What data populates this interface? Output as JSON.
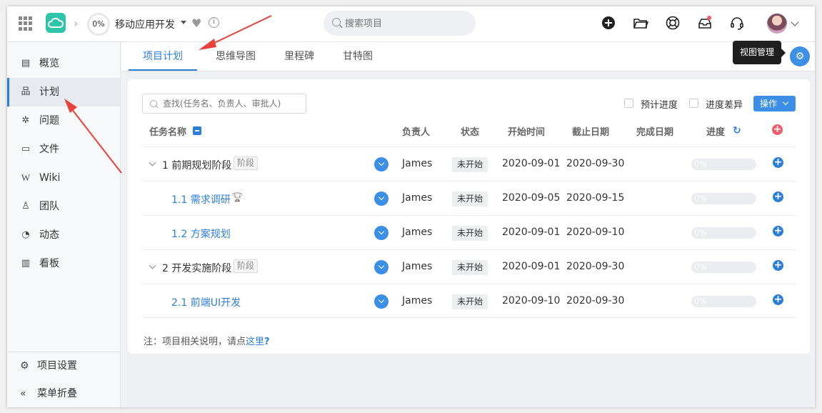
{
  "topbar": {
    "progress": "0%",
    "project_name": "移动应用开发",
    "search_placeholder": "搜索项目",
    "icons": [
      "apps-grid-icon",
      "cloud-logo-icon",
      "heart-icon",
      "info-icon",
      "add-icon",
      "folder-icon",
      "help-buoy-icon",
      "inbox-icon",
      "headset-icon"
    ],
    "notification_dot_color": "#f25b6b"
  },
  "sidebar": {
    "items": [
      {
        "label": "概览",
        "icon": "overview-icon"
      },
      {
        "label": "计划",
        "icon": "hierarchy-icon",
        "active": true
      },
      {
        "label": "问题",
        "icon": "bug-icon"
      },
      {
        "label": "文件",
        "icon": "folder-icon"
      },
      {
        "label": "Wiki",
        "icon": "wiki-icon"
      },
      {
        "label": "团队",
        "icon": "team-icon"
      },
      {
        "label": "动态",
        "icon": "activity-icon"
      },
      {
        "label": "看板",
        "icon": "board-icon"
      }
    ],
    "bottom": [
      {
        "label": "项目设置",
        "icon": "settings-icon"
      },
      {
        "label": "菜单折叠",
        "icon": "collapse-icon"
      }
    ]
  },
  "tabs": [
    {
      "label": "项目计划",
      "active": true
    },
    {
      "label": "思维导图"
    },
    {
      "label": "里程碑"
    },
    {
      "label": "甘特图"
    }
  ],
  "tooltip": "视图管理",
  "toolbar": {
    "filter_placeholder": "查找(任务名、负责人、审批人)",
    "checkbox_estimated": "预计进度",
    "checkbox_variance": "进度差异",
    "operation_button": "操作"
  },
  "table": {
    "headers": {
      "name": "任务名称",
      "owner": "负责人",
      "status": "状态",
      "start": "开始时间",
      "end": "截止日期",
      "finish": "完成日期",
      "progress": "进度"
    },
    "rows": [
      {
        "name": "1 前期规划阶段",
        "badge": "阶段",
        "owner": "James",
        "status": "未开始",
        "start": "2020-09-01",
        "end": "2020-09-30",
        "finish": "",
        "progress": "0%",
        "level": 0
      },
      {
        "name": "1.1 需求调研",
        "trophy": true,
        "owner": "James",
        "status": "未开始",
        "start": "2020-09-05",
        "end": "2020-09-15",
        "finish": "",
        "progress": "0%",
        "level": 1
      },
      {
        "name": "1.2 方案规划",
        "owner": "James",
        "status": "未开始",
        "start": "2020-09-01",
        "end": "2020-09-10",
        "finish": "",
        "progress": "0%",
        "level": 1
      },
      {
        "name": "2 开发实施阶段",
        "badge": "阶段",
        "owner": "James",
        "status": "未开始",
        "start": "2020-09-01",
        "end": "2020-09-30",
        "finish": "",
        "progress": "0%",
        "level": 0
      },
      {
        "name": "2.1 前端UI开发",
        "owner": "James",
        "status": "未开始",
        "start": "2020-09-10",
        "end": "2020-09-30",
        "finish": "",
        "progress": "0%",
        "level": 1
      }
    ]
  },
  "note": {
    "prefix": "注：项目相关说明，请点",
    "link": "这里",
    "suffix": "?"
  },
  "colors": {
    "accent": "#2b7fd9",
    "annotation_arrow": "#e8403b"
  }
}
